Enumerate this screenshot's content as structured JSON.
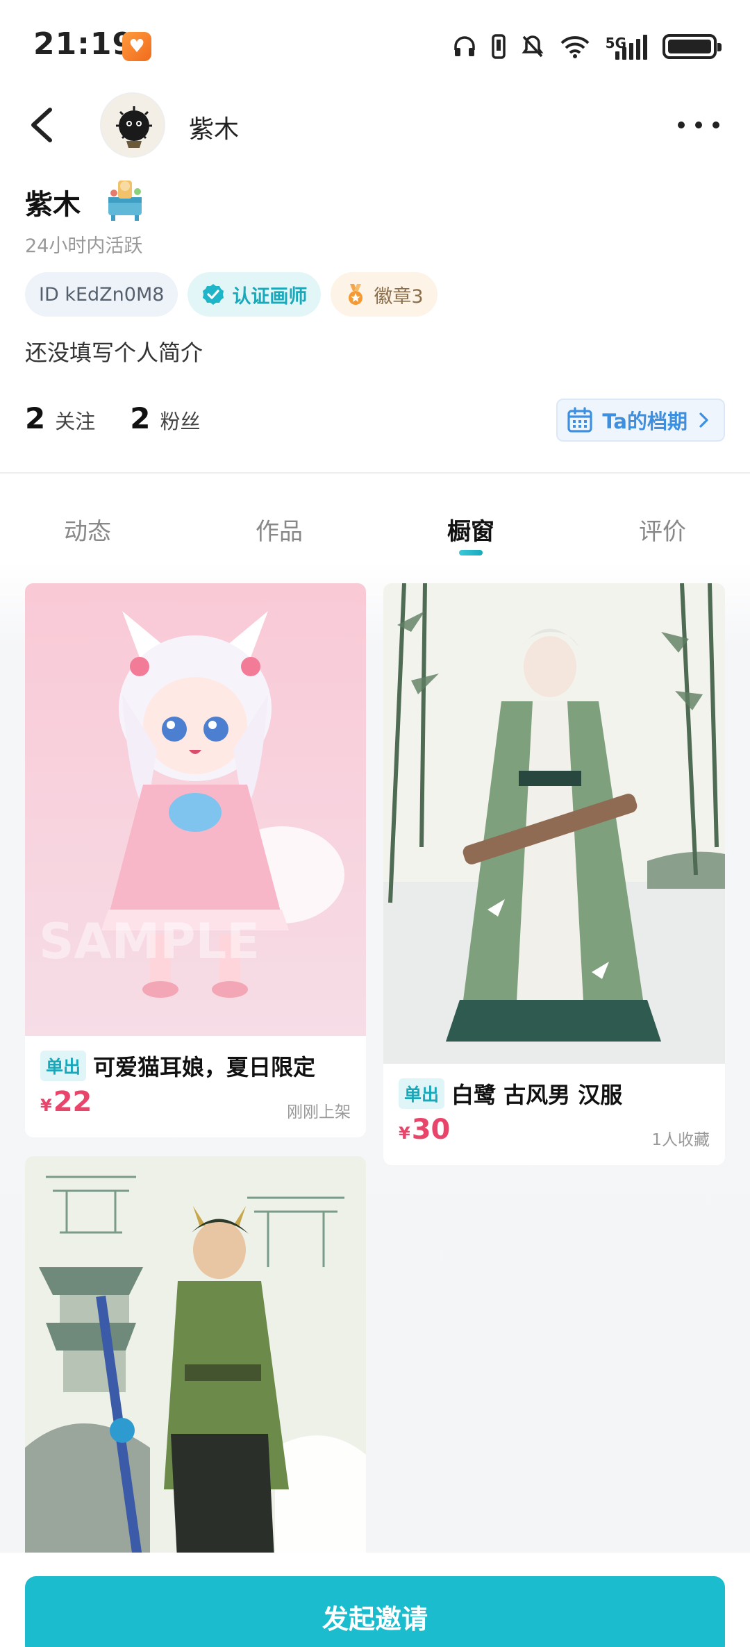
{
  "status_bar": {
    "time": "21:19",
    "network": "5G"
  },
  "nav": {
    "title": "紫木"
  },
  "profile": {
    "name": "紫木",
    "active_status": "24小时内活跃",
    "id_tag": "ID kEdZn0M8",
    "cert_tag": "认证画师",
    "medal_tag": "徽章3",
    "bio": "还没填写个人简介",
    "following_count": "2",
    "following_label": "关注",
    "followers_count": "2",
    "followers_label": "粉丝",
    "schedule_label": "Ta的档期"
  },
  "tabs": [
    {
      "label": "动态"
    },
    {
      "label": "作品"
    },
    {
      "label": "橱窗",
      "active": true
    },
    {
      "label": "评价"
    }
  ],
  "listings": [
    {
      "type": "单出",
      "title": "可爱猫耳娘，夏日限定",
      "currency": "¥",
      "price": "22",
      "meta": "刚刚上架"
    },
    {
      "type": "单出",
      "title": "白鹭  古风男  汉服",
      "currency": "¥",
      "price": "30",
      "meta": "1人收藏"
    },
    {
      "type": "",
      "title": "",
      "currency": "",
      "price": "",
      "meta": ""
    }
  ],
  "cta": {
    "label": "发起邀请"
  },
  "colors": {
    "accent": "#1bbccd",
    "price": "#e9446a",
    "link_blue": "#3d8fe0"
  }
}
